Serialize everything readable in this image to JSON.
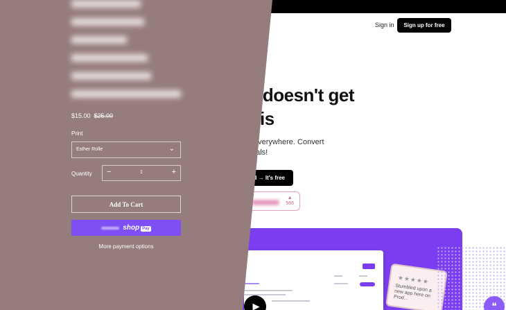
{
  "landing": {
    "nav": {
      "signin": "Sign in",
      "signup": "Sign up for free"
    },
    "hero": {
      "headline_line1": "onials doesn't get",
      "headline_line2": "han this",
      "sub_line1": ". Share them everywhere. Convert",
      "sub_line2": "close more deals!",
      "cta": "d → It's free"
    },
    "product_hunt": {
      "vote_count": "566"
    },
    "review_card": {
      "stars": "★★★★★",
      "quote": "Stumbled upon a new app here on Prod..."
    },
    "colors": {
      "accent": "#7b3df0",
      "topbar": "#000000",
      "chat": "#8b5cf6"
    },
    "icons": {
      "play": "play-icon",
      "chat": "chat-icon",
      "upvote": "upvote-triangle-icon"
    }
  },
  "product": {
    "price": "$15.00",
    "compare_at_price": "$25.00",
    "print_label": "Print",
    "print_selected": "Esther Rolle",
    "quantity_label": "Quantity",
    "quantity": "1",
    "add_to_cart": "Add To Cart",
    "shop_pay": {
      "shop": "shop",
      "pay": "Pay"
    },
    "more_payment": "More payment options",
    "overlay_color": "#967d7d",
    "shop_pay_color": "#7e4ff5"
  }
}
